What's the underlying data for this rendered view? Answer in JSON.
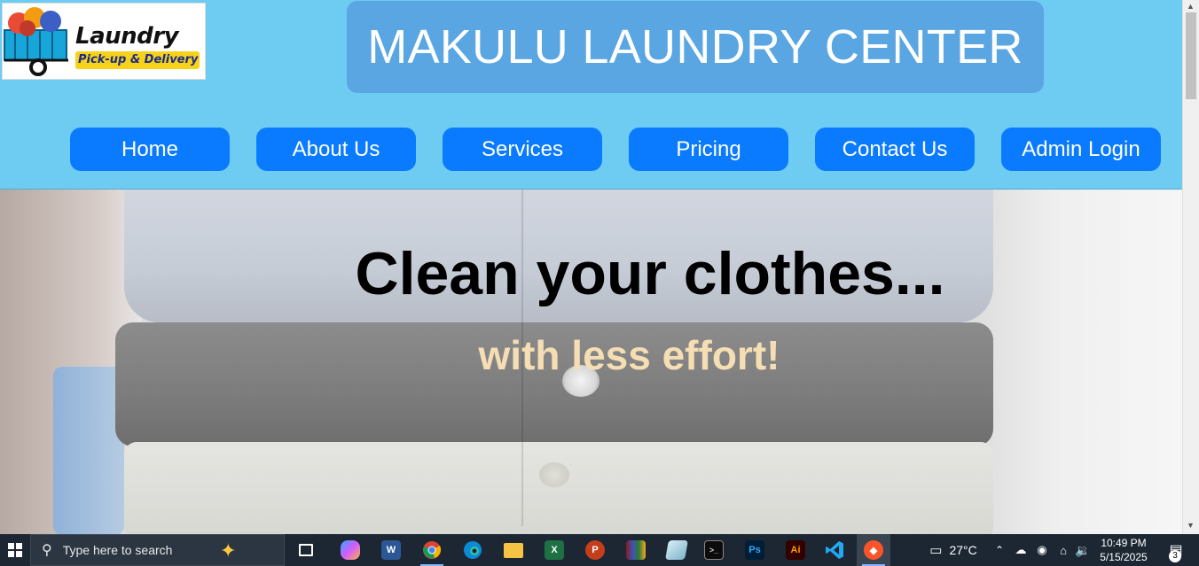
{
  "logo": {
    "word": "Laundry",
    "tagline": "Pick-up & Delivery"
  },
  "site_title": "MAKULU LAUNDRY CENTER",
  "nav": [
    {
      "label": "Home"
    },
    {
      "label": "About Us"
    },
    {
      "label": "Services"
    },
    {
      "label": "Pricing"
    },
    {
      "label": "Contact Us"
    },
    {
      "label": "Admin Login"
    }
  ],
  "hero": {
    "title": "Clean your clothes...",
    "subtitle": "with less effort!"
  },
  "taskbar": {
    "search_placeholder": "Type here to search",
    "apps": [
      {
        "icon": "task-view-icon"
      },
      {
        "icon": "copilot-icon"
      },
      {
        "icon": "word-icon",
        "glyph": "W",
        "color": "#2b5797"
      },
      {
        "icon": "chrome-icon"
      },
      {
        "icon": "edge-icon"
      },
      {
        "icon": "file-explorer-icon"
      },
      {
        "icon": "excel-icon",
        "glyph": "X",
        "color": "#1e7145"
      },
      {
        "icon": "powerpoint-icon",
        "glyph": "P",
        "color": "#c43e1c"
      },
      {
        "icon": "winrar-icon"
      },
      {
        "icon": "app-icon"
      },
      {
        "icon": "terminal-icon"
      },
      {
        "icon": "photoshop-icon",
        "glyph": "Ps",
        "color": "#001e36"
      },
      {
        "icon": "illustrator-icon",
        "glyph": "Ai",
        "color": "#330000"
      },
      {
        "icon": "vscode-icon"
      },
      {
        "icon": "brave-icon"
      }
    ],
    "weather": "27°C",
    "time": "10:49 PM",
    "date": "5/15/2025",
    "notification_count": "3"
  },
  "colors": {
    "header_bg": "#6ecbf2",
    "title_box_bg": "#5aa6e2",
    "nav_button_bg": "#0a7bff",
    "hero_subtitle": "#f5deb3"
  }
}
